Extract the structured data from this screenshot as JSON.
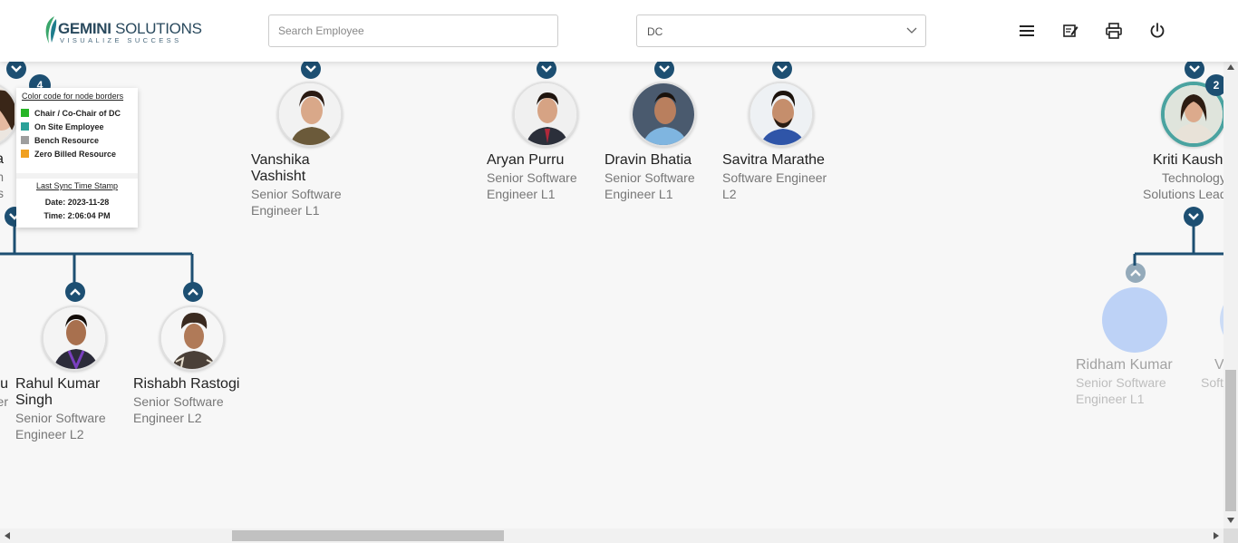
{
  "header": {
    "logo_name_bold": "GEMINI",
    "logo_name_thin": " SOLUTIONS",
    "logo_tagline": "VISUALIZE SUCCESS",
    "search_placeholder": "Search Employee",
    "search_value": "",
    "department_selected": "DC",
    "icons": [
      "menu-icon",
      "notes-icon",
      "print-icon",
      "power-icon"
    ]
  },
  "legend": {
    "title": "Color code for node borders",
    "items": [
      {
        "label": "Chair / Co-Chair of DC",
        "color": "#27b527"
      },
      {
        "label": "On Site Employee",
        "color": "#2aa198"
      },
      {
        "label": "Bench Resource",
        "color": "#9e9e9e"
      },
      {
        "label": "Zero Billed Resource",
        "color": "#f0a020"
      }
    ],
    "sync_title": "Last Sync Time Stamp",
    "sync_date": "Date: 2023-11-28",
    "sync_time": "Time: 2:06:04 PM"
  },
  "nodes": {
    "partial_left_top": {
      "name": "eta",
      "title_1": "chn",
      "title_2": "ons"
    },
    "partial_left_top_badge": "4",
    "vanshika": {
      "name_1": "Vanshika",
      "name_2": "Vashisht",
      "title_1": "Senior Software",
      "title_2": "Engineer L1"
    },
    "aryan": {
      "name_1": "Aryan Purru",
      "title_1": "Senior Software",
      "title_2": "Engineer L1"
    },
    "dravin": {
      "name_1": "Dravin Bhatia",
      "title_1": "Senior Software",
      "title_2": "Engineer L1"
    },
    "savitra": {
      "name_1": "Savitra Marathe",
      "title_1": "Software Engineer",
      "title_2": "L2"
    },
    "kriti": {
      "name_1": "Kriti Kaush",
      "title_1": "Technology",
      "title_2": "Solutions Lead",
      "badge": "2"
    },
    "partial_left_bottom": {
      "name": "u",
      "title": "er"
    },
    "rahul": {
      "name_1": "Rahul Kumar",
      "name_2": "Singh",
      "title_1": "Senior Software",
      "title_2": "Engineer L2"
    },
    "rishabh": {
      "name_1": "Rishabh Rastogi",
      "title_1": "Senior Software",
      "title_2": "Engineer L2"
    },
    "ridham": {
      "name_1": "Ridham Kumar",
      "title_1": "Senior Software",
      "title_2": "Engineer L1"
    },
    "partial_right_bottom": {
      "name": "V",
      "title": "Soft"
    }
  },
  "colors": {
    "link": "#1d4f72",
    "toggle": "#1d4f72",
    "ridham_placeholder": "#a9c6f5"
  }
}
